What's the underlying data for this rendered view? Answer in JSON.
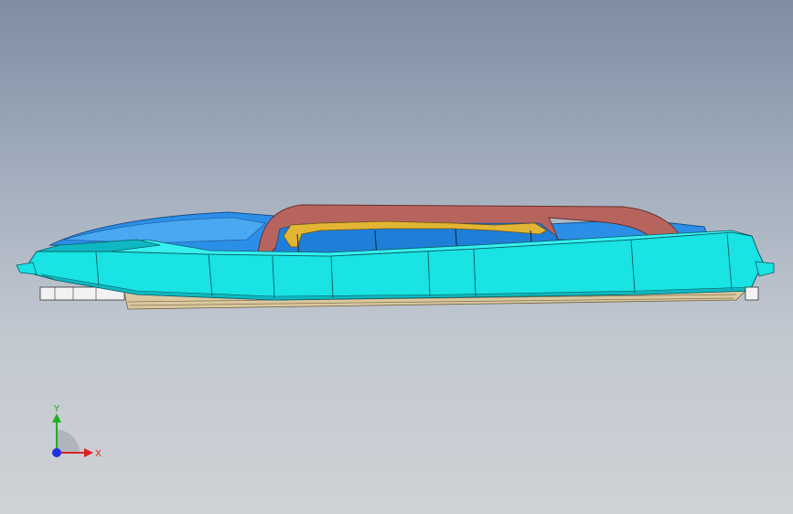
{
  "viewport": {
    "background_top": "#7f8da3",
    "background_bottom": "#cfd2d6"
  },
  "model": {
    "colors": {
      "body": "#19e3e3",
      "body_dark": "#0fb8c0",
      "upper_shell": "#2b8fe8",
      "handle": "#b8645e",
      "bracket": "#e3b534",
      "base": "#d9c8a0"
    }
  },
  "triad": {
    "x_label": "X",
    "y_label": "Y",
    "x_color": "#e02020",
    "y_color": "#20b020",
    "z_color": "#2030e0"
  }
}
